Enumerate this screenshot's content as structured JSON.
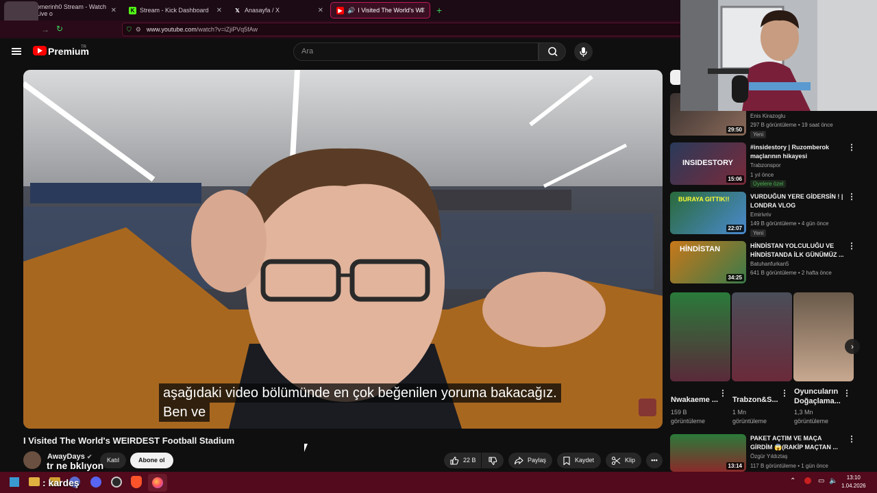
{
  "browser": {
    "tabs": [
      {
        "label": "omerinh0 Stream - Watch Live o",
        "icon": "kick-icon"
      },
      {
        "label": "Stream - Kick Dashboard",
        "icon": "kick-icon"
      },
      {
        "label": "Anasayfa / X",
        "icon": "x-icon"
      },
      {
        "label": "I Visited The World's WEIRD",
        "icon": "youtube-icon"
      }
    ],
    "url_host": "www.youtube.com",
    "url_path": "/watch?v=iZjiPVq5fAw"
  },
  "header": {
    "brand": "Premium",
    "region": "TR",
    "search_placeholder": "Ara"
  },
  "video": {
    "caption_line1": "aşağıdaki video bölümünde en çok beğenilen yoruma bakacağız.",
    "caption_line2": "Ben ve",
    "title": "I Visited The World's WEIRDEST Football Stadium",
    "channel": "AwayDays",
    "join_label": "Katıl",
    "subscribe_label": "Abone ol",
    "like_count": "22 B",
    "share_label": "Paylaş",
    "save_label": "Kaydet",
    "clip_label": "Klip"
  },
  "recommendations": [
    {
      "title": "",
      "channel": "Enis Kirazoglu",
      "meta": "297 B görüntüleme • 19 saat önce",
      "badge": "Yeni",
      "duration": "29:50"
    },
    {
      "title": "#insidestory | Ruzomberok maçlarının hikayesi",
      "channel": "Trabzonspor",
      "meta": "1 yıl önce",
      "badge": "Üyelere özel",
      "duration": "15:06"
    },
    {
      "title": "VURDUĞUN YERE GİDERSİN ! | LONDRA VLOG",
      "channel": "Emirivriv",
      "meta": "149 B görüntüleme • 4 gün önce",
      "badge": "Yeni",
      "duration": "22:07"
    },
    {
      "title": "HİNDİSTAN YOLCULUĞU VE HİNDİSTANDA İLK GÜNÜMÜZ ...",
      "channel": "Batuhanfurkan5",
      "meta": "641 B görüntüleme • 2 hafta önce",
      "badge": "",
      "duration": "34:25"
    }
  ],
  "shorts": [
    {
      "title": "Nwakaeme ...",
      "views_line1": "159 B",
      "views_line2": "görüntüleme"
    },
    {
      "title": "Trabzon&S...",
      "views_line1": "1 Mn",
      "views_line2": "görüntüleme"
    },
    {
      "title": "Oyuncuların Doğaçlama...",
      "views_line1": "1,3 Mn",
      "views_line2": "görüntüleme"
    }
  ],
  "rec_last": {
    "title": "PAKET AÇTIM VE MAÇA GİRDİM 😱(RAKİP MAÇTAN ...",
    "channel": "Özgür Yıldıztaş",
    "meta": "117 B görüntüleme • 1 gün önce",
    "duration": "13:14"
  },
  "overlay": {
    "chat1": "tr ne bklıyon",
    "chat2": ": kardeş"
  },
  "taskbar": {
    "time": "13:10",
    "date": "1.04.2026"
  }
}
